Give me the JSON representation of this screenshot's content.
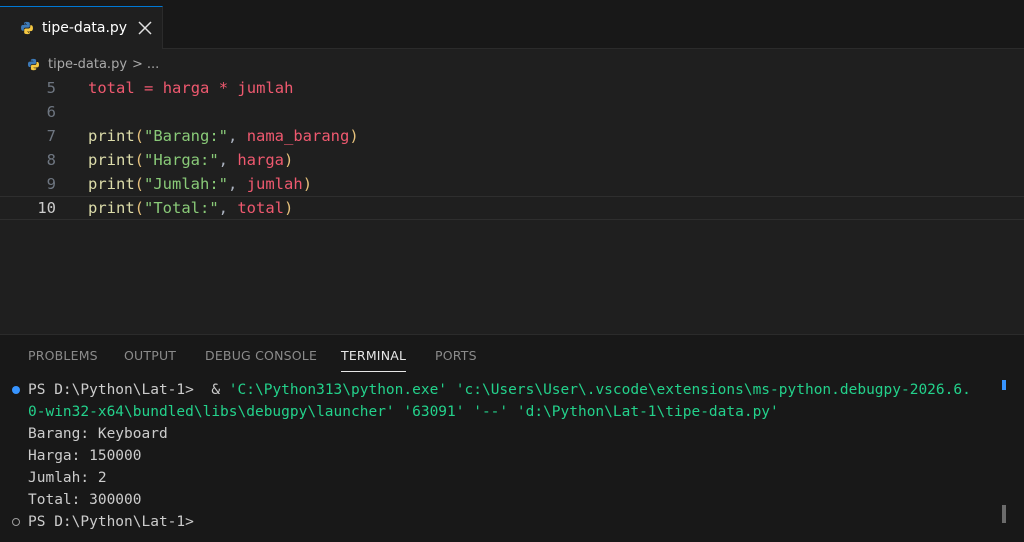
{
  "tab": {
    "filename": "tipe-data.py"
  },
  "breadcrumb": {
    "file": "tipe-data.py",
    "separator": ">",
    "ellipsis": "..."
  },
  "editor": {
    "lines": [
      {
        "num": "5",
        "tokens": [
          {
            "t": "total",
            "c": "t-var"
          },
          {
            "t": " ",
            "c": "t-plain"
          },
          {
            "t": "=",
            "c": "t-op"
          },
          {
            "t": " ",
            "c": "t-plain"
          },
          {
            "t": "harga",
            "c": "t-var"
          },
          {
            "t": " ",
            "c": "t-plain"
          },
          {
            "t": "*",
            "c": "t-op"
          },
          {
            "t": " ",
            "c": "t-plain"
          },
          {
            "t": "jumlah",
            "c": "t-var"
          }
        ]
      },
      {
        "num": "6",
        "tokens": []
      },
      {
        "num": "7",
        "tokens": [
          {
            "t": "print",
            "c": "t-fn"
          },
          {
            "t": "(",
            "c": "t-punc"
          },
          {
            "t": "\"Barang:\"",
            "c": "t-str"
          },
          {
            "t": ", ",
            "c": "t-plain"
          },
          {
            "t": "nama_barang",
            "c": "t-var"
          },
          {
            "t": ")",
            "c": "t-punc"
          }
        ]
      },
      {
        "num": "8",
        "tokens": [
          {
            "t": "print",
            "c": "t-fn"
          },
          {
            "t": "(",
            "c": "t-punc"
          },
          {
            "t": "\"Harga:\"",
            "c": "t-str"
          },
          {
            "t": ", ",
            "c": "t-plain"
          },
          {
            "t": "harga",
            "c": "t-var"
          },
          {
            "t": ")",
            "c": "t-punc"
          }
        ]
      },
      {
        "num": "9",
        "tokens": [
          {
            "t": "print",
            "c": "t-fn"
          },
          {
            "t": "(",
            "c": "t-punc"
          },
          {
            "t": "\"Jumlah:\"",
            "c": "t-str"
          },
          {
            "t": ", ",
            "c": "t-plain"
          },
          {
            "t": "jumlah",
            "c": "t-var"
          },
          {
            "t": ")",
            "c": "t-punc"
          }
        ]
      },
      {
        "num": "10",
        "current": true,
        "tokens": [
          {
            "t": "print",
            "c": "t-fn"
          },
          {
            "t": "(",
            "c": "t-punc"
          },
          {
            "t": "\"Total:\"",
            "c": "t-str"
          },
          {
            "t": ", ",
            "c": "t-plain"
          },
          {
            "t": "total",
            "c": "t-var"
          },
          {
            "t": ")",
            "c": "t-punc"
          }
        ]
      }
    ]
  },
  "panel": {
    "tabs": [
      {
        "label": "PROBLEMS",
        "active": false
      },
      {
        "label": "OUTPUT",
        "active": false
      },
      {
        "label": "DEBUG CONSOLE",
        "active": false
      },
      {
        "label": "TERMINAL",
        "active": true
      },
      {
        "label": "PORTS",
        "active": false
      }
    ]
  },
  "terminal": {
    "prompt1": "PS D:\\Python\\Lat-1>",
    "amp": "  & ",
    "cmd_line1": "'C:\\Python313\\python.exe' 'c:\\Users\\User\\.vscode\\extensions\\ms-python.debugpy-2026.6.",
    "cmd_line2": "0-win32-x64\\bundled\\libs\\debugpy\\launcher' '63091' '--' 'd:\\Python\\Lat-1\\tipe-data.py'",
    "output": [
      "Barang: Keyboard",
      "Harga: 150000",
      "Jumlah: 2",
      "Total: 300000"
    ],
    "prompt2": "PS D:\\Python\\Lat-1>"
  },
  "colors": {
    "accent": "#0078d4",
    "status_blue": "#3794ff",
    "terminal_arg": "#23d18b"
  }
}
